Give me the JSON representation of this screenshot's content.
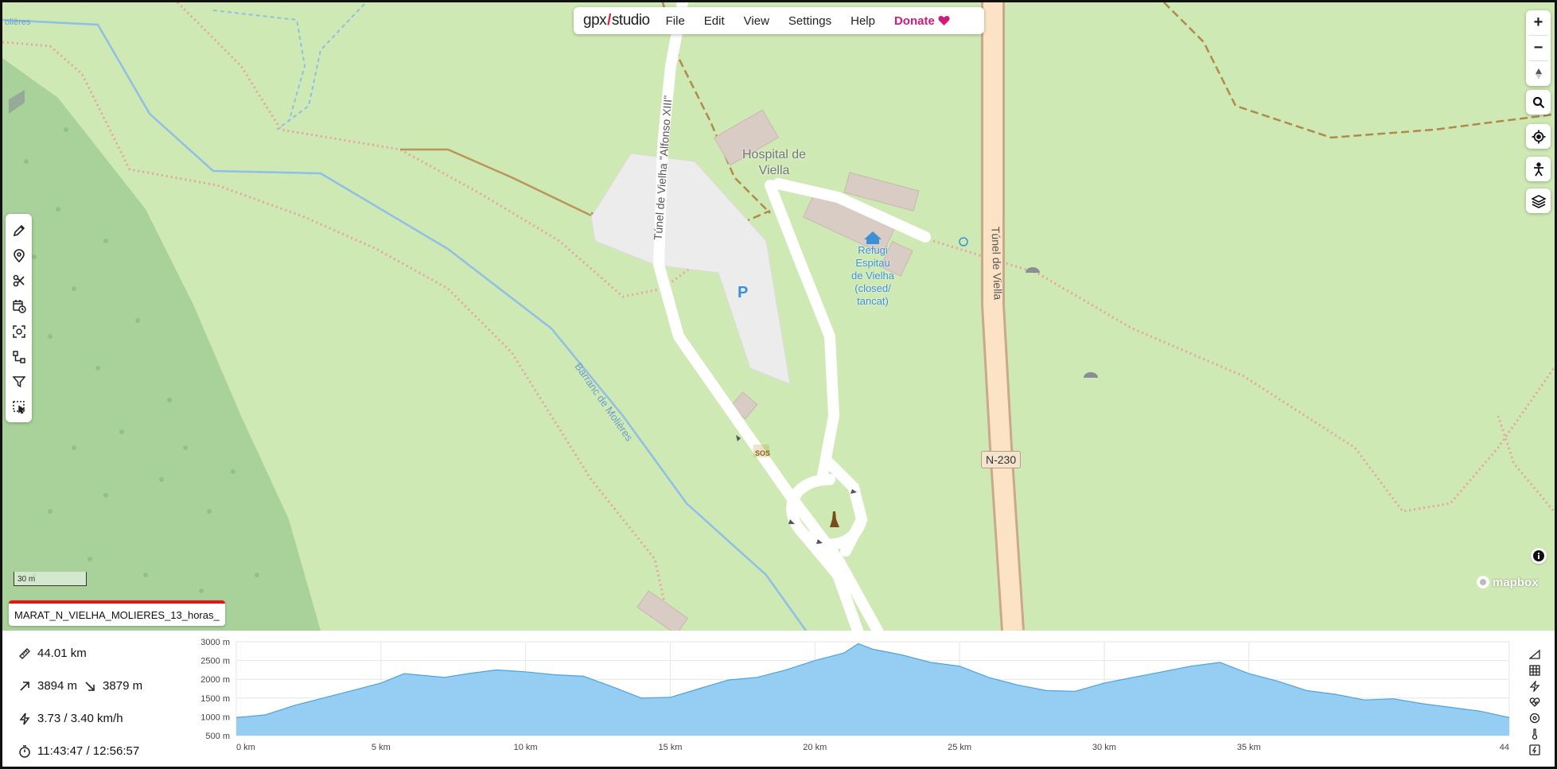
{
  "app": {
    "logo_left": "gpx",
    "logo_slash": "/",
    "logo_right": "studio"
  },
  "menu": {
    "file": "File",
    "edit": "Edit",
    "view": "View",
    "settings": "Settings",
    "help": "Help",
    "donate": "Donate"
  },
  "map": {
    "labels": {
      "molieres_corner": "olières",
      "hospital_line1": "Hospital de",
      "hospital_line2": "Viella",
      "tunnel_vielha": "Túnel de Vielha \"Alfonso XIII\"",
      "tunnel_viella": "Túnel de Viella",
      "barranc": "Barranc de Molières",
      "refugi_1": "Refugi",
      "refugi_2": "Espitau",
      "refugi_3": "de Vielha",
      "refugi_4": "(closed/",
      "refugi_5": "tancat)",
      "parking": "P",
      "road_badge": "N-230",
      "sos": "SOS"
    },
    "scale_label": "30 m",
    "attribution": "mapbox",
    "file_name": "MARAT_N_VIELHA_MOLIERES_13_horas_"
  },
  "stats": {
    "distance": "44.01 km",
    "ascent": "3894 m",
    "descent": "3879 m",
    "speed": "3.73 / 3.40 km/h",
    "time": "11:43:47 / 12:56:57"
  },
  "colors": {
    "map_bg": "#cfe9b4",
    "forest": "#a9d19a",
    "profile_fill": "#96cdf2",
    "profile_stroke": "#4aa3df",
    "donate": "#d11b7a",
    "track_red": "#e8141c"
  },
  "chart_data": {
    "type": "area",
    "xlabel": "",
    "ylabel": "",
    "x_ticks": [
      "0 km",
      "5 km",
      "10 km",
      "15 km",
      "20 km",
      "25 km",
      "30 km",
      "35 km",
      "44"
    ],
    "x_tick_values": [
      0,
      5,
      10,
      15,
      20,
      25,
      30,
      35,
      44
    ],
    "y_ticks": [
      "500 m",
      "1000 m",
      "1500 m",
      "2000 m",
      "2500 m",
      "3000 m"
    ],
    "y_tick_values": [
      500,
      1000,
      1500,
      2000,
      2500,
      3000
    ],
    "xlim": [
      0,
      44
    ],
    "ylim": [
      500,
      3000
    ],
    "grid": true,
    "x": [
      0,
      1,
      2,
      3,
      4,
      5,
      5.8,
      6.5,
      7.2,
      8,
      9,
      10,
      11,
      12,
      13,
      14,
      15,
      16,
      17,
      18,
      19,
      20,
      21,
      21.5,
      22,
      23,
      24,
      25,
      26,
      27,
      28,
      29,
      30,
      31,
      32,
      33,
      34,
      35,
      36,
      37,
      38,
      39,
      40,
      41,
      42,
      43,
      44
    ],
    "y": [
      980,
      1050,
      1300,
      1500,
      1700,
      1900,
      2150,
      2100,
      2050,
      2150,
      2250,
      2200,
      2120,
      2080,
      1800,
      1500,
      1520,
      1750,
      1980,
      2050,
      2250,
      2500,
      2700,
      2950,
      2800,
      2650,
      2450,
      2350,
      2050,
      1850,
      1700,
      1680,
      1900,
      2050,
      2200,
      2350,
      2450,
      2150,
      1950,
      1700,
      1600,
      1450,
      1480,
      1350,
      1250,
      1150,
      980
    ]
  }
}
